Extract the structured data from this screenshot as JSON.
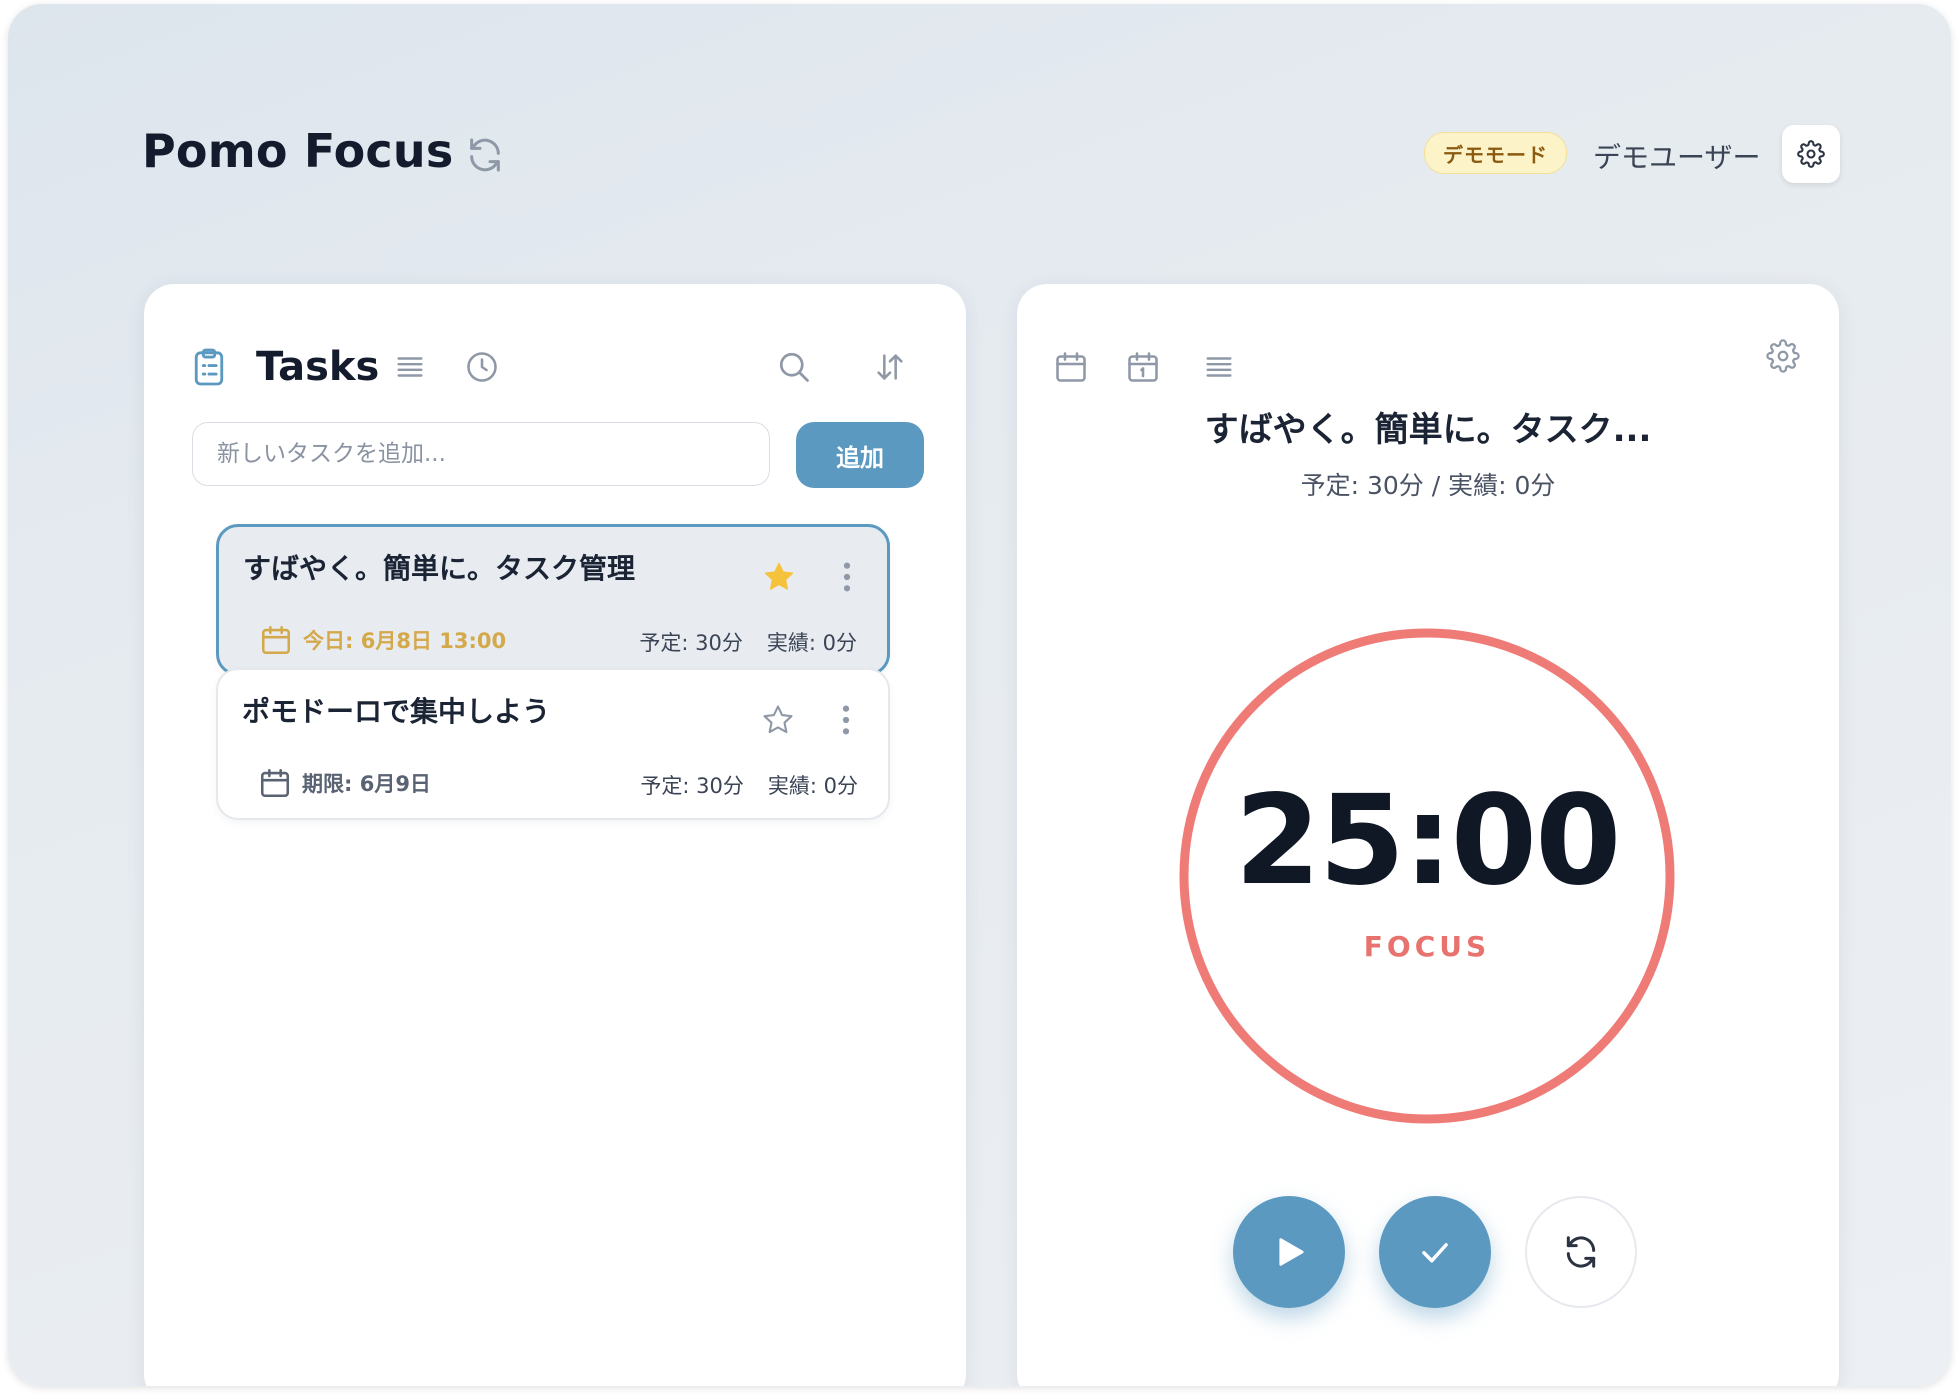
{
  "header": {
    "title": "Pomo Focus",
    "demo_badge": "デモモード",
    "user_name": "デモユーザー"
  },
  "tasks_panel": {
    "title": "Tasks",
    "input_placeholder": "新しいタスクを追加...",
    "add_button": "追加",
    "tasks": [
      {
        "title": "すばやく。簡単に。タスク管理",
        "starred": true,
        "selected": true,
        "date_label": "今日: 6月8日 13:00",
        "planned": "予定: 30分",
        "actual": "実績: 0分"
      },
      {
        "title": "ポモドーロで集中しよう",
        "starred": false,
        "selected": false,
        "date_label": "期限: 6月9日",
        "planned": "予定: 30分",
        "actual": "実績: 0分"
      }
    ]
  },
  "timer_panel": {
    "task_title": "すばやく。簡単に。タスク...",
    "task_meta": "予定: 30分 / 実績: 0分",
    "time": "25:00",
    "mode": "FOCUS"
  },
  "colors": {
    "accent": "#5b99c1",
    "focus_ring": "#ef7b77",
    "focus_text": "#e8726e",
    "star_active": "#f5c23c",
    "today_date": "#d4a94a",
    "badge_bg": "#fdf3c8",
    "badge_text": "#8a5a10"
  },
  "icons": {
    "header_refresh": "refresh-icon",
    "header_settings": "gear-icon",
    "tasks_header": "clipboard-icon",
    "list_view": "list-icon",
    "history": "clock-icon",
    "search": "search-icon",
    "sort": "sort-icon",
    "calendar": "calendar-icon",
    "calendar_day": "calendar-day-icon",
    "timer_settings": "gear-icon",
    "play": "play-icon",
    "complete": "check-icon",
    "reset": "refresh-icon"
  }
}
